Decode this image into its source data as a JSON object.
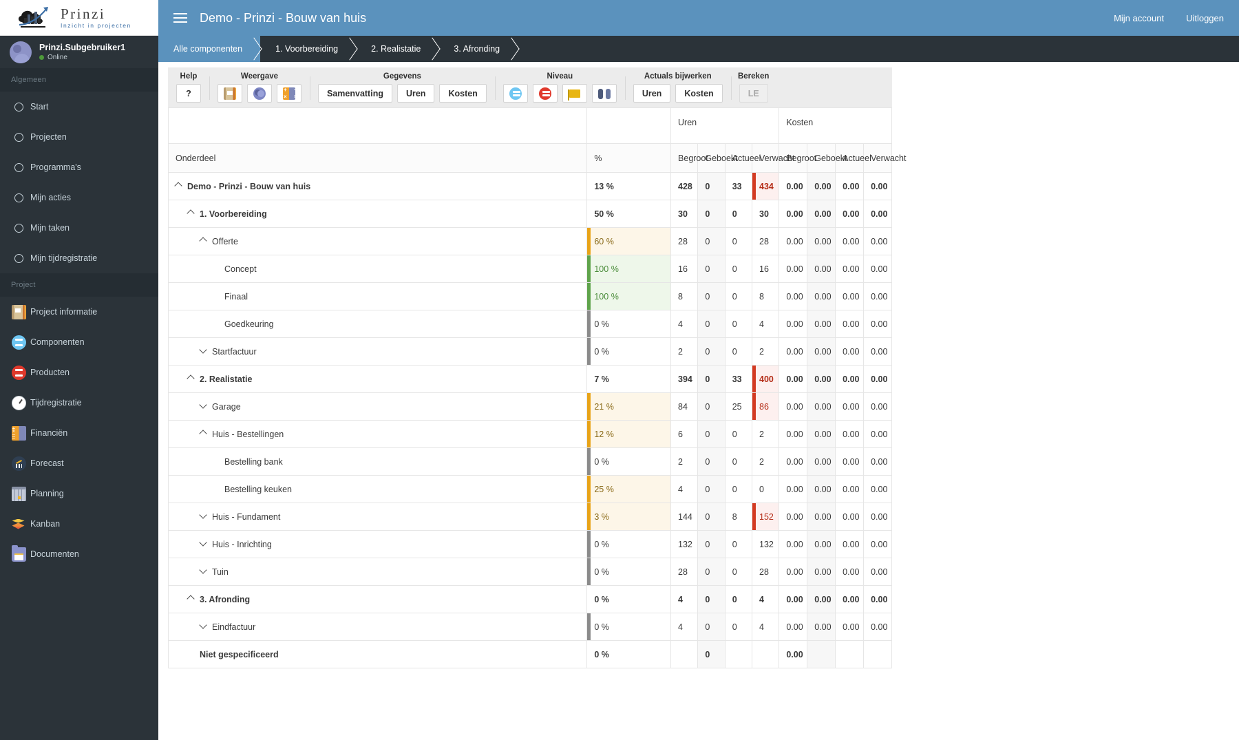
{
  "brand": {
    "name": "Prinzi",
    "tagline": "Inzicht in projecten"
  },
  "user": {
    "name": "Prinzi.Subgebruiker1",
    "status": "Online"
  },
  "sidebar": {
    "group_general": "Algemeen",
    "group_project": "Project",
    "general_items": [
      {
        "label": "Start",
        "icon": "circle-icon"
      },
      {
        "label": "Projecten",
        "icon": "circle-icon"
      },
      {
        "label": "Programma's",
        "icon": "circle-icon"
      },
      {
        "label": "Mijn acties",
        "icon": "circle-icon"
      },
      {
        "label": "Mijn taken",
        "icon": "circle-icon"
      },
      {
        "label": "Mijn tijdregistratie",
        "icon": "circle-icon"
      }
    ],
    "project_items": [
      {
        "label": "Project informatie",
        "icon": "notebook-icon"
      },
      {
        "label": "Componenten",
        "icon": "components-icon"
      },
      {
        "label": "Producten",
        "icon": "products-icon"
      },
      {
        "label": "Tijdregistratie",
        "icon": "stopwatch-icon"
      },
      {
        "label": "Financiën",
        "icon": "calculator-icon"
      },
      {
        "label": "Forecast",
        "icon": "forecast-chart-icon"
      },
      {
        "label": "Planning",
        "icon": "calendar-icon"
      },
      {
        "label": "Kanban",
        "icon": "layers-icon"
      },
      {
        "label": "Documenten",
        "icon": "folder-icon"
      }
    ]
  },
  "topbar": {
    "title": "Demo - Prinzi - Bouw van huis",
    "account_label": "Mijn account",
    "logout_label": "Uitloggen"
  },
  "breadcrumb": [
    {
      "label": "Alle componenten",
      "active": true
    },
    {
      "label": "1. Voorbereiding",
      "active": false
    },
    {
      "label": "2. Realistatie",
      "active": false
    },
    {
      "label": "3. Afronding",
      "active": false
    }
  ],
  "toolbar": {
    "groups": [
      {
        "title": "Help",
        "buttons": [
          {
            "label": "?",
            "kind": "text",
            "name": "help-button"
          }
        ]
      },
      {
        "title": "Weergave",
        "buttons": [
          {
            "label": "",
            "kind": "icon",
            "icon": "notebook-icon",
            "name": "view-details-button"
          },
          {
            "label": "",
            "kind": "icon",
            "icon": "people-icon",
            "name": "view-resources-button"
          },
          {
            "label": "",
            "kind": "icon",
            "icon": "calculator-icon",
            "name": "view-calculation-button"
          }
        ]
      },
      {
        "title": "Gegevens",
        "buttons": [
          {
            "label": "Samenvatting",
            "kind": "text",
            "name": "data-summary-button"
          },
          {
            "label": "Uren",
            "kind": "text",
            "name": "data-hours-button"
          },
          {
            "label": "Kosten",
            "kind": "text",
            "name": "data-costs-button"
          }
        ]
      },
      {
        "title": "Niveau",
        "buttons": [
          {
            "label": "",
            "kind": "icon",
            "icon": "components-icon",
            "name": "level-components-button"
          },
          {
            "label": "",
            "kind": "icon",
            "icon": "products-icon",
            "name": "level-products-button"
          },
          {
            "label": "",
            "kind": "icon",
            "icon": "flag-icon",
            "name": "level-milestone-button"
          },
          {
            "label": "",
            "kind": "icon",
            "icon": "binoculars-icon",
            "name": "level-overview-button"
          }
        ]
      },
      {
        "title": "Actuals bijwerken",
        "buttons": [
          {
            "label": "Uren",
            "kind": "text",
            "name": "actuals-hours-button"
          },
          {
            "label": "Kosten",
            "kind": "text",
            "name": "actuals-costs-button"
          }
        ]
      },
      {
        "title": "Bereken",
        "buttons": [
          {
            "label": "LE",
            "kind": "text",
            "disabled": true,
            "name": "calculate-le-button"
          }
        ]
      }
    ]
  },
  "table": {
    "group_headers": {
      "uren": "Uren",
      "kosten": "Kosten"
    },
    "columns": [
      "Onderdeel",
      "%",
      "Begroot",
      "Geboekt",
      "Actueel",
      "Verwacht",
      "Begroot",
      "Geboekt",
      "Actueel",
      "Verwacht"
    ],
    "rows": [
      {
        "name": "Demo - Prinzi - Bouw van huis",
        "level": 0,
        "chev": "up",
        "bold": true,
        "pct": "13 %",
        "pct_bar": "none",
        "pct_bg": "none",
        "u_begroot": "428",
        "u_geboekt": "0",
        "u_actueel": "33",
        "u_verwacht": "434",
        "verwacht_state": "over",
        "k_begroot": "0.00",
        "k_geboekt": "0.00",
        "k_actueel": "0.00",
        "k_verwacht": "0.00"
      },
      {
        "name": "1. Voorbereiding",
        "level": 1,
        "chev": "up",
        "bold": true,
        "pct": "50 %",
        "pct_bar": "none",
        "pct_bg": "none",
        "u_begroot": "30",
        "u_geboekt": "0",
        "u_actueel": "0",
        "u_verwacht": "30",
        "verwacht_state": "normal",
        "k_begroot": "0.00",
        "k_geboekt": "0.00",
        "k_actueel": "0.00",
        "k_verwacht": "0.00"
      },
      {
        "name": "Offerte",
        "level": 2,
        "chev": "up",
        "bold": false,
        "pct": "60 %",
        "pct_bar": "orange",
        "pct_bg": "orange",
        "u_begroot": "28",
        "u_geboekt": "0",
        "u_actueel": "0",
        "u_verwacht": "28",
        "verwacht_state": "normal",
        "k_begroot": "0.00",
        "k_geboekt": "0.00",
        "k_actueel": "0.00",
        "k_verwacht": "0.00"
      },
      {
        "name": "Concept",
        "level": 3,
        "chev": "none",
        "bold": false,
        "pct": "100 %",
        "pct_bar": "green",
        "pct_bg": "green",
        "u_begroot": "16",
        "u_geboekt": "0",
        "u_actueel": "0",
        "u_verwacht": "16",
        "verwacht_state": "normal",
        "k_begroot": "0.00",
        "k_geboekt": "0.00",
        "k_actueel": "0.00",
        "k_verwacht": "0.00"
      },
      {
        "name": "Finaal",
        "level": 3,
        "chev": "none",
        "bold": false,
        "pct": "100 %",
        "pct_bar": "green",
        "pct_bg": "green",
        "u_begroot": "8",
        "u_geboekt": "0",
        "u_actueel": "0",
        "u_verwacht": "8",
        "verwacht_state": "normal",
        "k_begroot": "0.00",
        "k_geboekt": "0.00",
        "k_actueel": "0.00",
        "k_verwacht": "0.00"
      },
      {
        "name": "Goedkeuring",
        "level": 3,
        "chev": "none",
        "bold": false,
        "pct": "0 %",
        "pct_bar": "grey",
        "pct_bg": "none",
        "u_begroot": "4",
        "u_geboekt": "0",
        "u_actueel": "0",
        "u_verwacht": "4",
        "verwacht_state": "normal",
        "k_begroot": "0.00",
        "k_geboekt": "0.00",
        "k_actueel": "0.00",
        "k_verwacht": "0.00"
      },
      {
        "name": "Startfactuur",
        "level": 2,
        "chev": "down",
        "bold": false,
        "pct": "0 %",
        "pct_bar": "grey",
        "pct_bg": "none",
        "u_begroot": "2",
        "u_geboekt": "0",
        "u_actueel": "0",
        "u_verwacht": "2",
        "verwacht_state": "normal",
        "k_begroot": "0.00",
        "k_geboekt": "0.00",
        "k_actueel": "0.00",
        "k_verwacht": "0.00"
      },
      {
        "name": "2. Realistatie",
        "level": 1,
        "chev": "up",
        "bold": true,
        "pct": "7 %",
        "pct_bar": "none",
        "pct_bg": "none",
        "u_begroot": "394",
        "u_geboekt": "0",
        "u_actueel": "33",
        "u_verwacht": "400",
        "verwacht_state": "over",
        "k_begroot": "0.00",
        "k_geboekt": "0.00",
        "k_actueel": "0.00",
        "k_verwacht": "0.00"
      },
      {
        "name": "Garage",
        "level": 2,
        "chev": "down",
        "bold": false,
        "pct": "21 %",
        "pct_bar": "orange",
        "pct_bg": "orange",
        "u_begroot": "84",
        "u_geboekt": "0",
        "u_actueel": "25",
        "u_verwacht": "86",
        "verwacht_state": "over",
        "k_begroot": "0.00",
        "k_geboekt": "0.00",
        "k_actueel": "0.00",
        "k_verwacht": "0.00"
      },
      {
        "name": "Huis - Bestellingen",
        "level": 2,
        "chev": "up",
        "bold": false,
        "pct": "12 %",
        "pct_bar": "orange",
        "pct_bg": "orange",
        "u_begroot": "6",
        "u_geboekt": "0",
        "u_actueel": "0",
        "u_verwacht": "2",
        "verwacht_state": "normal",
        "k_begroot": "0.00",
        "k_geboekt": "0.00",
        "k_actueel": "0.00",
        "k_verwacht": "0.00"
      },
      {
        "name": "Bestelling bank",
        "level": 3,
        "chev": "none",
        "bold": false,
        "pct": "0 %",
        "pct_bar": "grey",
        "pct_bg": "none",
        "u_begroot": "2",
        "u_geboekt": "0",
        "u_actueel": "0",
        "u_verwacht": "2",
        "verwacht_state": "normal",
        "k_begroot": "0.00",
        "k_geboekt": "0.00",
        "k_actueel": "0.00",
        "k_verwacht": "0.00"
      },
      {
        "name": "Bestelling keuken",
        "level": 3,
        "chev": "none",
        "bold": false,
        "pct": "25 %",
        "pct_bar": "orange",
        "pct_bg": "orange",
        "u_begroot": "4",
        "u_geboekt": "0",
        "u_actueel": "0",
        "u_verwacht": "0",
        "verwacht_state": "normal",
        "k_begroot": "0.00",
        "k_geboekt": "0.00",
        "k_actueel": "0.00",
        "k_verwacht": "0.00"
      },
      {
        "name": "Huis - Fundament",
        "level": 2,
        "chev": "down",
        "bold": false,
        "pct": "3 %",
        "pct_bar": "orange",
        "pct_bg": "orange",
        "u_begroot": "144",
        "u_geboekt": "0",
        "u_actueel": "8",
        "u_verwacht": "152",
        "verwacht_state": "over",
        "k_begroot": "0.00",
        "k_geboekt": "0.00",
        "k_actueel": "0.00",
        "k_verwacht": "0.00"
      },
      {
        "name": "Huis - Inrichting",
        "level": 2,
        "chev": "down",
        "bold": false,
        "pct": "0 %",
        "pct_bar": "grey",
        "pct_bg": "none",
        "u_begroot": "132",
        "u_geboekt": "0",
        "u_actueel": "0",
        "u_verwacht": "132",
        "verwacht_state": "normal",
        "k_begroot": "0.00",
        "k_geboekt": "0.00",
        "k_actueel": "0.00",
        "k_verwacht": "0.00"
      },
      {
        "name": "Tuin",
        "level": 2,
        "chev": "down",
        "bold": false,
        "pct": "0 %",
        "pct_bar": "grey",
        "pct_bg": "none",
        "u_begroot": "28",
        "u_geboekt": "0",
        "u_actueel": "0",
        "u_verwacht": "28",
        "verwacht_state": "normal",
        "k_begroot": "0.00",
        "k_geboekt": "0.00",
        "k_actueel": "0.00",
        "k_verwacht": "0.00"
      },
      {
        "name": "3. Afronding",
        "level": 1,
        "chev": "up",
        "bold": true,
        "pct": "0 %",
        "pct_bar": "none",
        "pct_bg": "none",
        "u_begroot": "4",
        "u_geboekt": "0",
        "u_actueel": "0",
        "u_verwacht": "4",
        "verwacht_state": "normal",
        "k_begroot": "0.00",
        "k_geboekt": "0.00",
        "k_actueel": "0.00",
        "k_verwacht": "0.00"
      },
      {
        "name": "Eindfactuur",
        "level": 2,
        "chev": "down",
        "bold": false,
        "pct": "0 %",
        "pct_bar": "grey",
        "pct_bg": "none",
        "u_begroot": "4",
        "u_geboekt": "0",
        "u_actueel": "0",
        "u_verwacht": "4",
        "verwacht_state": "normal",
        "k_begroot": "0.00",
        "k_geboekt": "0.00",
        "k_actueel": "0.00",
        "k_verwacht": "0.00"
      },
      {
        "name": "Niet gespecificeerd",
        "level": 1,
        "chev": "none",
        "bold": false,
        "pct": "0 %",
        "pct_bar": "none",
        "pct_bg": "none",
        "u_begroot": "",
        "u_geboekt": "0",
        "u_actueel": "",
        "u_verwacht": "",
        "verwacht_state": "normal",
        "k_begroot": "0.00",
        "k_geboekt": "",
        "k_actueel": "",
        "k_verwacht": ""
      }
    ]
  },
  "colors": {
    "brand_blue": "#5b92bd",
    "sidebar_dark": "#2b3339",
    "over_red": "#c0392b",
    "progress_orange": "#e8a317",
    "progress_green": "#5fa34b",
    "progress_grey": "#8a8a8a"
  }
}
